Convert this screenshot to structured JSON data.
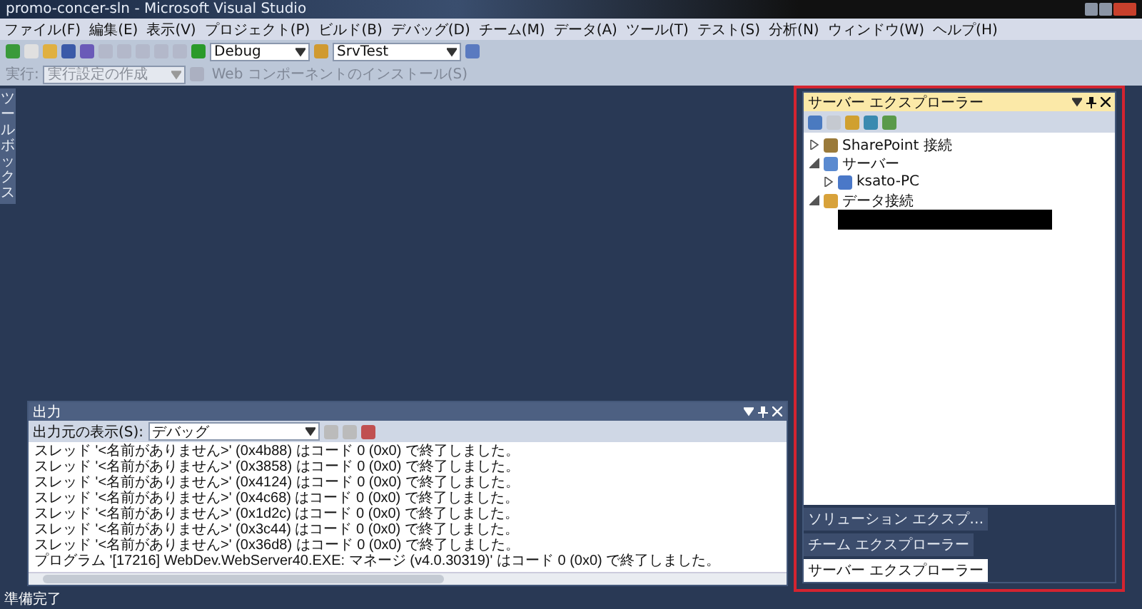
{
  "window": {
    "title": "promo-concer-sln - Microsoft Visual Studio"
  },
  "menu": [
    "ファイル(F)",
    "編集(E)",
    "表示(V)",
    "プロジェクト(P)",
    "ビルド(B)",
    "デバッグ(D)",
    "チーム(M)",
    "データ(A)",
    "ツール(T)",
    "テスト(S)",
    "分析(N)",
    "ウィンドウ(W)",
    "ヘルプ(H)"
  ],
  "toolbar": {
    "configuration": "Debug",
    "project": "SrvTest"
  },
  "web_toolbar": {
    "run_label": "実行:",
    "run_placeholder": "実行設定の作成",
    "install_button": "Web コンポーネントのインストール(S)",
    "disabled": true
  },
  "toolbox": {
    "label": "ツールボックス"
  },
  "output": {
    "title": "出力",
    "source_label": "出力元の表示(S):",
    "source": "デバッグ",
    "lines": [
      "スレッド '<名前がありません>' (0x4b88) はコード 0 (0x0) で終了しました。",
      "スレッド '<名前がありません>' (0x3858) はコード 0 (0x0) で終了しました。",
      "スレッド '<名前がありません>' (0x4124) はコード 0 (0x0) で終了しました。",
      "スレッド '<名前がありません>' (0x4c68) はコード 0 (0x0) で終了しました。",
      "スレッド '<名前がありません>' (0x1d2c) はコード 0 (0x0) で終了しました。",
      "スレッド '<名前がありません>' (0x3c44) はコード 0 (0x0) で終了しました。",
      "スレッド '<名前がありません>' (0x36d8) はコード 0 (0x0) で終了しました。",
      "プログラム '[17216] WebDev.WebServer40.EXE: マネージ (v4.0.30319)' はコード 0 (0x0) で終了しました。"
    ]
  },
  "server_explorer": {
    "title": "サーバー エクスプローラー",
    "tree": [
      {
        "label": "SharePoint 接続",
        "expanded": false
      },
      {
        "label": "サーバー",
        "expanded": true,
        "children": [
          {
            "label": "ksato-PC",
            "expanded": false
          }
        ]
      },
      {
        "label": "データ接続",
        "expanded": true,
        "children": [
          {
            "kind": "redacted"
          }
        ]
      }
    ],
    "tabs": [
      {
        "label": "ソリューション エクスプ…",
        "selected": false
      },
      {
        "label": "チーム エクスプローラー",
        "selected": false
      },
      {
        "label": "サーバー エクスプローラー",
        "selected": true
      }
    ]
  },
  "status_bar": {
    "text": "準備完了"
  }
}
